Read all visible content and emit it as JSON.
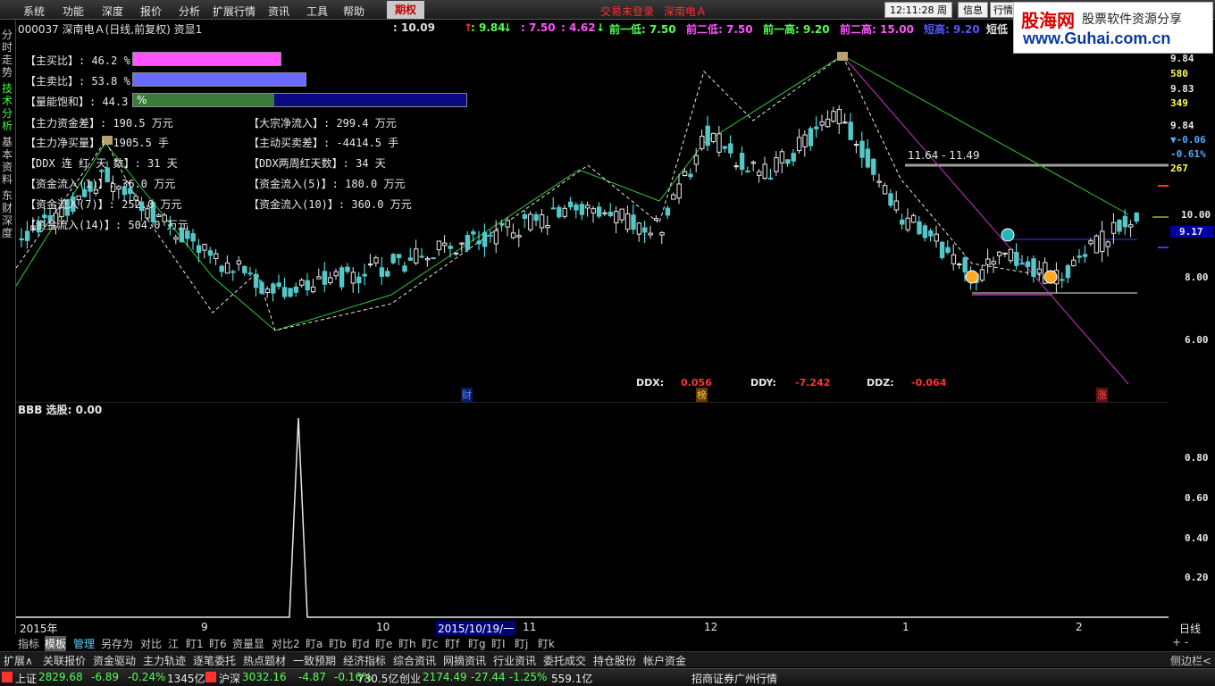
{
  "menu": {
    "items": [
      "系统",
      "功能",
      "深度",
      "报价",
      "分析",
      "扩展行情",
      "资讯",
      "工具",
      "帮助"
    ],
    "active": "期权",
    "center_left": "交易未登录",
    "center_right": "深南电Ａ",
    "clock": "12:11:28 周三",
    "btn_info": "信息",
    "btn_quote": "行情"
  },
  "watermark": {
    "brand": "股海网",
    "slogan": "股票软件资源分享",
    "url": "www.Guhai.com.cn"
  },
  "leftnav": [
    "分时走势",
    "技术分析",
    "基本资料",
    "东财深度"
  ],
  "info": {
    "title": "000037 深南电Ａ(日线,前复权) 资显1",
    "v1": ": 10.09",
    "v2": ": 9.84",
    "v3": ": 7.50",
    "v4": ": 4.62",
    "low1": "前一低: 7.50",
    "low2": "前二低: 7.50",
    "high1": "前一高: 9.20",
    "high2": "前二高: 15.00",
    "extra1": "短高: 9.20",
    "extra2": "短低"
  },
  "indicators": {
    "buy_ratio": "【主买比】: 46.2 %",
    "sell_ratio": "【主卖比】: 53.8 %",
    "saturation_label": "【量能饱和】: 44.3",
    "saturation_pct": "%",
    "main_diff": "【主力资金差】: 190.5 万元",
    "block_inflow": "【大宗净流入】: 299.4 万元",
    "main_net_buy": "【主力净买量】: 1905.5 手",
    "active_diff": "【主动买卖差】: -4414.5 手",
    "ddx_red": "【DDX 连 红 天 数】: 31 天",
    "ddx_2w": "【DDX两周红天数】: 34 天",
    "inflow1": "【资金流入(1)】: 36.0 万元",
    "inflow5": "【资金流入(5)】: 180.0 万元",
    "inflow7": "【资金流入(7)】: 252.0 万元",
    "inflow10": "【资金流入(10)】: 360.0 万元",
    "inflow14": "【资金流入(14)】: 504.0 万元",
    "buy_pct": 0.462,
    "sell_pct": 0.538,
    "sat_pct": 0.443
  },
  "chart": {
    "range_label": "11.64 - 11.49",
    "ddx_label": "DDX:",
    "ddx_value": "0.056",
    "ddy_label": "DDY:",
    "ddy_value": "-7.242",
    "ddz_label": "DDZ:",
    "ddz_value": "-0.064",
    "marker_cai": "财",
    "marker_bang": "榜",
    "marker_zhang": "涨",
    "price_axis": [
      "9.84",
      "580",
      "9.83",
      "349",
      "9.84",
      "▼-0.06",
      "-0.61%",
      "267",
      "10.00",
      "9.17",
      "8.00",
      "6.00"
    ],
    "lower_title": "BBB 选股: 0.00",
    "lower_axis": [
      "0.80",
      "0.60",
      "0.40",
      "0.20"
    ],
    "dates": [
      "2015年",
      "9",
      "10",
      "2015/10/19/一",
      "11",
      "12",
      "1",
      "2"
    ],
    "period": "日线",
    "candle_seed": 37
  },
  "bottom_tabs": [
    "指标",
    "模板",
    "管理",
    "另存为",
    "对比",
    "江",
    "盯1",
    "盯6",
    "资量显",
    "对比2",
    "盯a",
    "盯b",
    "盯d",
    "盯e",
    "盯h",
    "盯c",
    "盯f",
    "盯g",
    "盯I",
    "盯j",
    "盯k"
  ],
  "bottom_right": "+ -",
  "func_items": [
    "扩展∧",
    "关联报价",
    "资金驱动",
    "主力轨迹",
    "逐笔委托",
    "热点题材",
    "一致预期",
    "经济指标",
    "综合资讯",
    "网摘资讯",
    "行业资讯",
    "委托成交",
    "持仓股份",
    "帐户资金"
  ],
  "func_right": "侧边栏<",
  "status": {
    "sh_label": "上证",
    "sh_price": "2829.68",
    "sh_chg": "-6.89",
    "sh_pct": "-0.24%",
    "sh_amt": "1345亿",
    "sz_label": "沪深",
    "sz_price": "3032.16",
    "sz_chg": "-4.87",
    "sz_pct": "-0.16%",
    "sz_amt": "730.5亿",
    "cy_label": "创业",
    "cy_price": "2174.49",
    "cy_chg": "-27.44",
    "cy_pct": "-1.25%",
    "cy_amt": "559.1亿",
    "broker": "招商证券广州行情"
  },
  "colors": {
    "up": "#ff3232",
    "down": "#54ffff",
    "bg": "#000000",
    "label_yellow": "#ffff54"
  }
}
